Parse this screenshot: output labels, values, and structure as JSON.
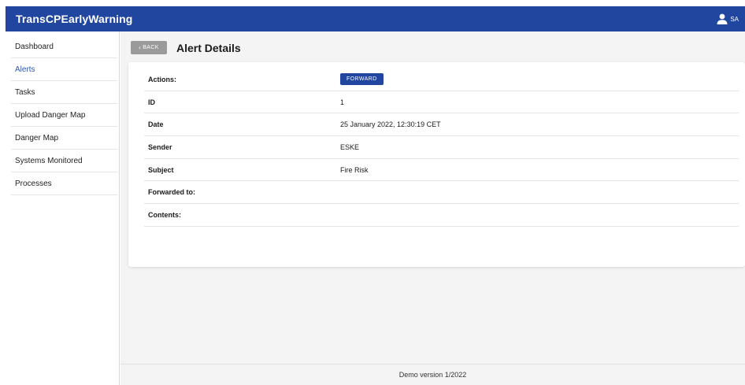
{
  "app": {
    "title": "TransCPEarlyWarning",
    "user_initials": "SA",
    "user_icon": "person-icon",
    "brand_color": "#2146a0"
  },
  "sidebar": {
    "items": [
      {
        "label": "Dashboard",
        "active": false
      },
      {
        "label": "Alerts",
        "active": true
      },
      {
        "label": "Tasks",
        "active": false
      },
      {
        "label": "Upload Danger Map",
        "active": false
      },
      {
        "label": "Danger Map",
        "active": false
      },
      {
        "label": "Systems Monitored",
        "active": false
      },
      {
        "label": "Processes",
        "active": false
      }
    ]
  },
  "page": {
    "back_label": "BACK",
    "back_icon": "chevron-left-icon",
    "title": "Alert Details"
  },
  "details": {
    "actions_label": "Actions:",
    "forward_label": "FORWARD",
    "id_label": "ID",
    "id_value": "1",
    "date_label": "Date",
    "date_value": "25 January 2022, 12:30:19 CET",
    "sender_label": "Sender",
    "sender_value": "ESKE",
    "subject_label": "Subject",
    "subject_value": "Fire Risk",
    "forwarded_label": "Forwarded to:",
    "forwarded_value": "",
    "contents_label": "Contents:",
    "contents_value": ""
  },
  "footer": {
    "text": "Demo version 1/2022"
  }
}
